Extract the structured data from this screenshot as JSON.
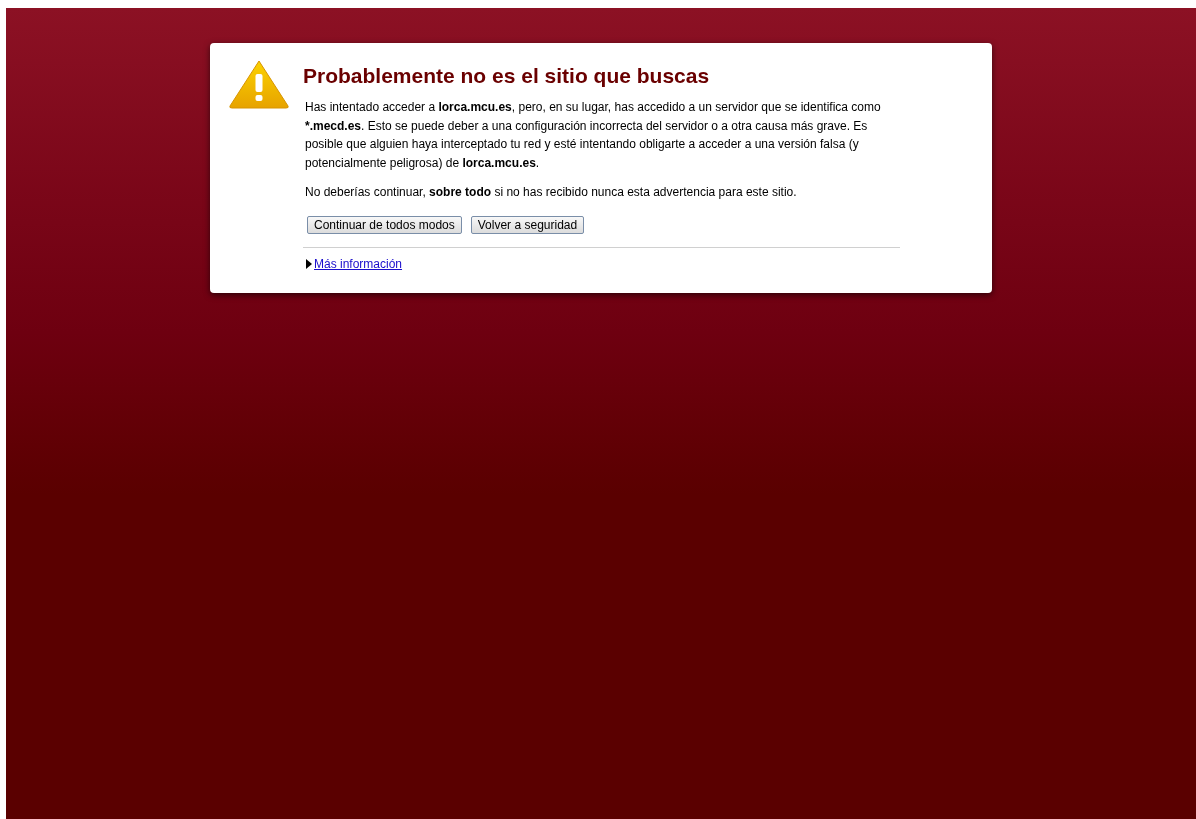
{
  "warning": {
    "title": "Probablemente no es el sitio que buscas",
    "paragraphs": [
      [
        {
          "text": "Has intentado acceder a ",
          "bold": false
        },
        {
          "text": "lorca.mcu.es",
          "bold": true
        },
        {
          "text": ", pero, en su lugar, has accedido a un servidor que se identifica como ",
          "bold": false
        },
        {
          "text": "*.mecd.es",
          "bold": true
        },
        {
          "text": ". Esto se puede deber a una configuración incorrecta del servidor o a otra causa más grave. Es posible que alguien haya interceptado tu red y esté intentando obligarte a acceder a una versión falsa (y potencialmente peligrosa) de ",
          "bold": false
        },
        {
          "text": "lorca.mcu.es",
          "bold": true
        },
        {
          "text": ".",
          "bold": false
        }
      ],
      [
        {
          "text": "No deberías continuar, ",
          "bold": false
        },
        {
          "text": "sobre todo",
          "bold": true
        },
        {
          "text": " si no has recibido nunca esta advertencia para este sitio.",
          "bold": false
        }
      ]
    ],
    "buttons": [
      "Continuar de todos modos",
      "Volver a seguridad"
    ],
    "details": {
      "label": "Más información",
      "expanded": false
    }
  }
}
